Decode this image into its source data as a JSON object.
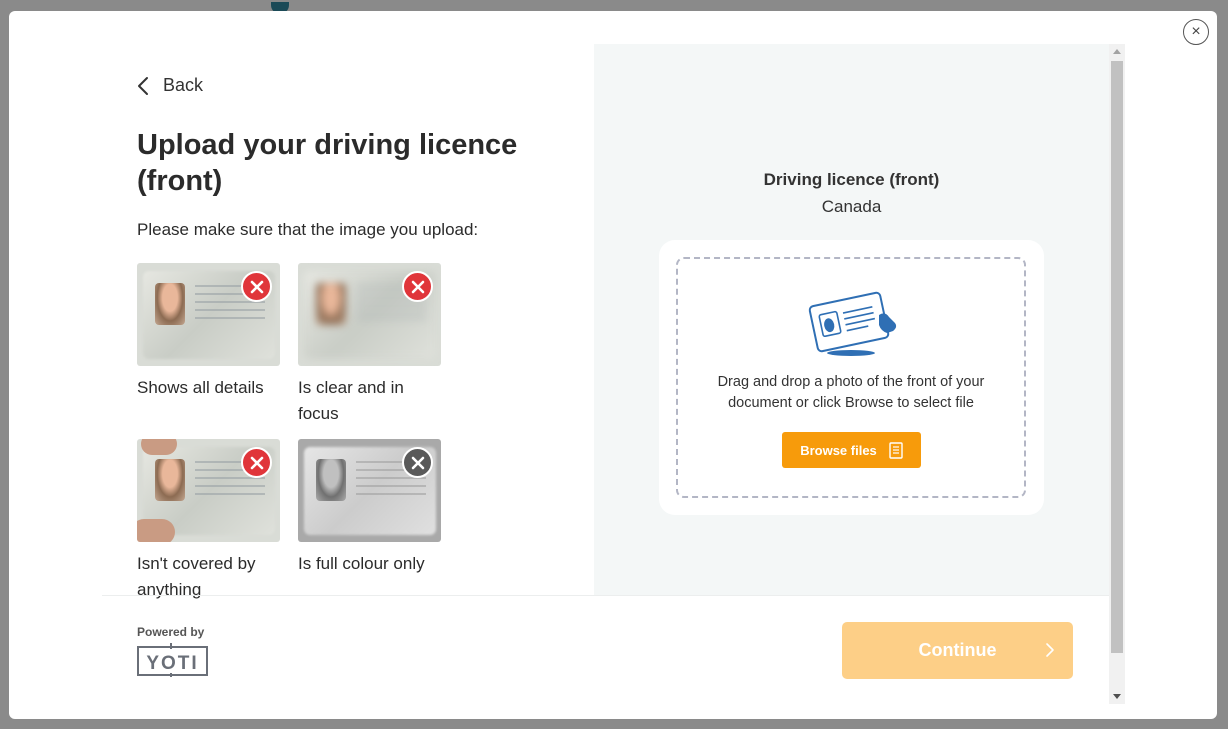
{
  "modal": {
    "close_label": "×"
  },
  "left": {
    "back_label": "Back",
    "title": "Upload your driving licence (front)",
    "subtitle": "Please make sure that the image you upload:",
    "requirements": [
      {
        "label": "Shows all details",
        "icon": "error-x-icon"
      },
      {
        "label": "Is clear and in focus",
        "icon": "error-x-icon"
      },
      {
        "label": "Isn't covered by anything",
        "icon": "error-x-icon"
      },
      {
        "label": "Is full colour only",
        "icon": "error-x-icon"
      }
    ]
  },
  "right": {
    "document_type": "Driving licence (front)",
    "country": "Canada",
    "drop_text": "Drag and drop a photo of the front of your document or click Browse to select file",
    "browse_label": "Browse files",
    "upload_icon": "id-card-tap-icon"
  },
  "footer": {
    "powered_by": "Powered by",
    "logo_text": "YOTI",
    "continue_label": "Continue"
  },
  "colors": {
    "accent_orange": "#f79b0b",
    "continue_disabled": "#fdcf87",
    "error_red": "#e0353a",
    "panel_bg": "#f4f7f7",
    "icon_blue": "#2f6fb4"
  }
}
